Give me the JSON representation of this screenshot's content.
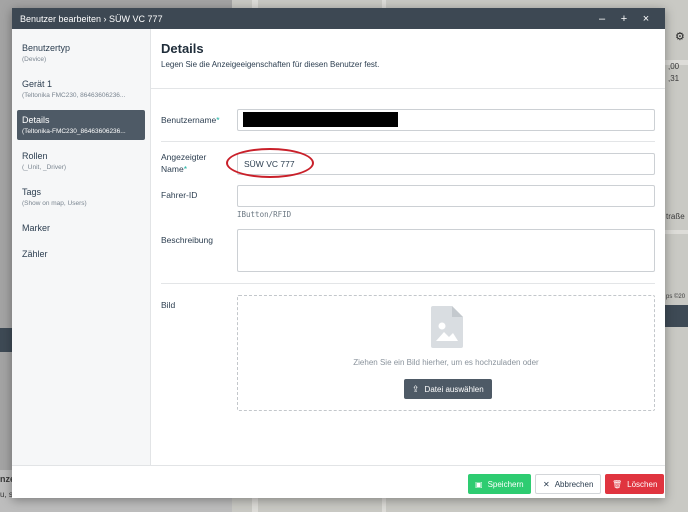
{
  "window": {
    "title": "Benutzer bearbeiten › SÜW VC 777",
    "controls": {
      "minimize": "–",
      "maximize": "+",
      "close": "×"
    }
  },
  "background": {
    "side_texts": [
      "nze",
      "u, s",
      ",00",
      ",31",
      "traße",
      "ps ©20"
    ]
  },
  "nav": {
    "items": [
      {
        "label": "Benutzertyp",
        "sub": "(Device)"
      },
      {
        "label": "Gerät 1",
        "sub": "(Teltonika FMC230, 86463606236..."
      },
      {
        "label": "Details",
        "sub": "(Teltonika-FMC230_86463606236..."
      },
      {
        "label": "Rollen",
        "sub": "(_Unit, _Driver)"
      },
      {
        "label": "Tags",
        "sub": "(Show on map, Users)"
      },
      {
        "label": "Marker",
        "sub": ""
      },
      {
        "label": "Zähler",
        "sub": ""
      }
    ]
  },
  "main": {
    "title": "Details",
    "subtitle": "Legen Sie die Anzeigeeigenschaften für diesen Benutzer fest.",
    "fields": {
      "username_label": "Benutzername",
      "display_name_label_1": "Angezeigter",
      "display_name_label_2": "Name",
      "display_name_value": "SÜW VC 777",
      "driver_id_label": "Fahrer-ID",
      "driver_id_value": "",
      "driver_id_hint": "IButton/RFID",
      "description_label": "Beschreibung",
      "description_value": "",
      "image_label": "Bild",
      "required_mark": "*"
    },
    "dropzone": {
      "text": "Ziehen Sie ein Bild hierher, um es hochzuladen oder",
      "button": "Datei auswählen"
    }
  },
  "footer": {
    "save": "Speichern",
    "cancel": "Abbrechen",
    "delete": "Löschen"
  },
  "colors": {
    "titlebar": "#3d4853",
    "active_nav": "#4e5a66",
    "save": "#2ecc71",
    "delete": "#e0343f",
    "required": "#1ab0a0",
    "annotation": "#c9202a"
  }
}
